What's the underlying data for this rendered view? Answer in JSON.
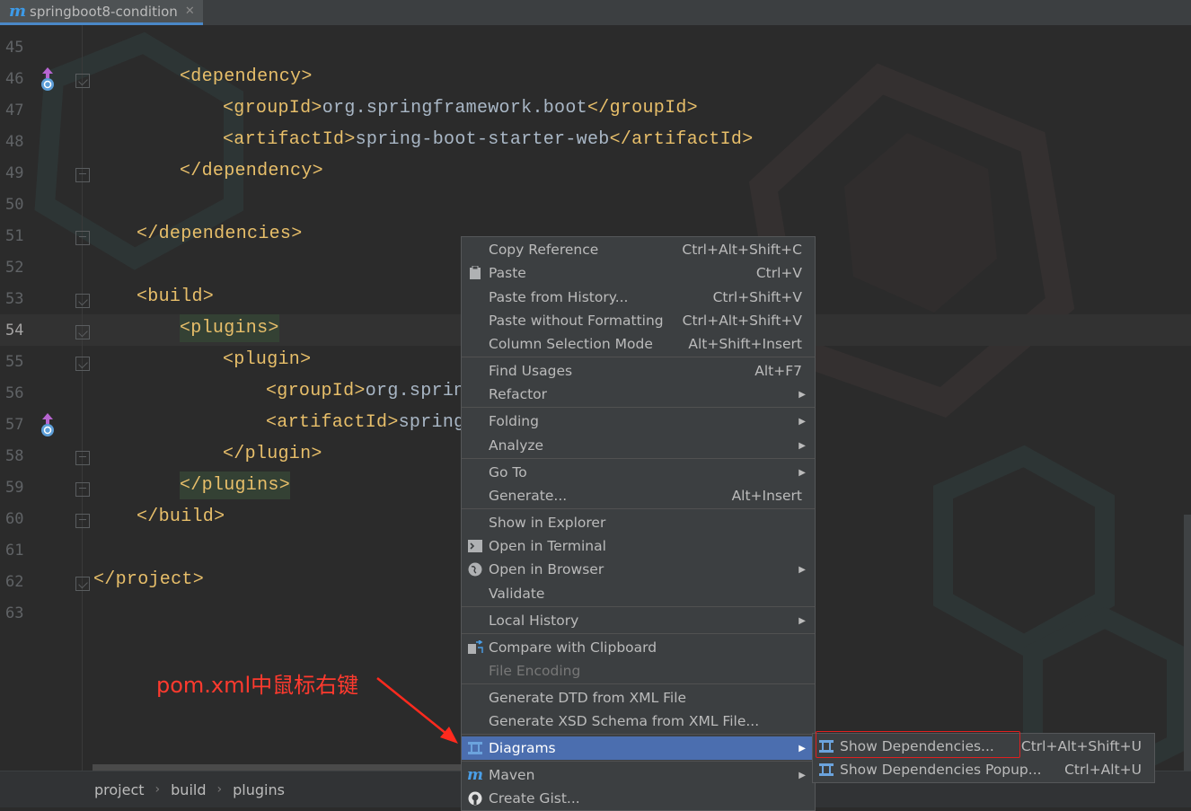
{
  "tab": {
    "title": "springboot8-condition",
    "icon": "maven-m-icon"
  },
  "editor": {
    "lines": [
      {
        "num": "45",
        "code": ""
      },
      {
        "num": "46",
        "code": "<dependency>"
      },
      {
        "num": "47",
        "code": "<groupId>org.springframework.boot</groupId>"
      },
      {
        "num": "48",
        "code": "<artifactId>spring-boot-starter-web</artifactId>"
      },
      {
        "num": "49",
        "code": "</dependency>"
      },
      {
        "num": "50",
        "code": ""
      },
      {
        "num": "51",
        "code": "</dependencies>"
      },
      {
        "num": "52",
        "code": ""
      },
      {
        "num": "53",
        "code": "<build>"
      },
      {
        "num": "54",
        "code": "<plugins>"
      },
      {
        "num": "55",
        "code": "<plugin>"
      },
      {
        "num": "56",
        "code": "<groupId>org.sprin"
      },
      {
        "num": "57",
        "code": "<artifactId>spring"
      },
      {
        "num": "58",
        "code": "</plugin>"
      },
      {
        "num": "59",
        "code": "</plugins>"
      },
      {
        "num": "60",
        "code": "</build>"
      },
      {
        "num": "61",
        "code": ""
      },
      {
        "num": "62",
        "code": "</project>"
      },
      {
        "num": "63",
        "code": ""
      }
    ],
    "active_line": "54"
  },
  "breadcrumb": [
    "project",
    "build",
    "plugins"
  ],
  "annotation": "pom.xml中鼠标右键",
  "context_menu": {
    "items": [
      {
        "label": "Copy Reference",
        "shortcut": "Ctrl+Alt+Shift+C"
      },
      {
        "label": "Paste",
        "shortcut": "Ctrl+V",
        "icon": "clipboard-icon"
      },
      {
        "label": "Paste from History...",
        "shortcut": "Ctrl+Shift+V"
      },
      {
        "label": "Paste without Formatting",
        "shortcut": "Ctrl+Alt+Shift+V"
      },
      {
        "label": "Column Selection Mode",
        "shortcut": "Alt+Shift+Insert"
      },
      {
        "label": "Find Usages",
        "shortcut": "Alt+F7"
      },
      {
        "label": "Refactor",
        "submenu": true
      },
      {
        "label": "Folding",
        "submenu": true
      },
      {
        "label": "Analyze",
        "submenu": true
      },
      {
        "label": "Go To",
        "submenu": true
      },
      {
        "label": "Generate...",
        "shortcut": "Alt+Insert"
      },
      {
        "label": "Show in Explorer"
      },
      {
        "label": "Open in Terminal",
        "icon": "terminal-icon"
      },
      {
        "label": "Open in Browser",
        "icon": "globe-icon",
        "submenu": true
      },
      {
        "label": "Validate"
      },
      {
        "label": "Local History",
        "submenu": true
      },
      {
        "label": "Compare with Clipboard",
        "icon": "compare-icon"
      },
      {
        "label": "File Encoding",
        "disabled": true
      },
      {
        "label": "Generate DTD from XML File"
      },
      {
        "label": "Generate XSD Schema from XML File..."
      },
      {
        "label": "Diagrams",
        "icon": "diagram-icon",
        "submenu": true,
        "selected": true
      },
      {
        "label": "Maven",
        "icon": "maven-icon",
        "submenu": true
      },
      {
        "label": "Create Gist...",
        "icon": "github-icon"
      }
    ]
  },
  "submenu": {
    "items": [
      {
        "label": "Show Dependencies...",
        "shortcut": "Ctrl+Alt+Shift+U",
        "icon": "diagram-icon"
      },
      {
        "label": "Show Dependencies Popup...",
        "shortcut": "Ctrl+Alt+U",
        "icon": "diagram-icon"
      }
    ]
  },
  "colors": {
    "accent": "#4b6eaf",
    "tag": "#e8bf6a",
    "text": "#a9b7c6",
    "annotation": "#ff3a2e"
  }
}
